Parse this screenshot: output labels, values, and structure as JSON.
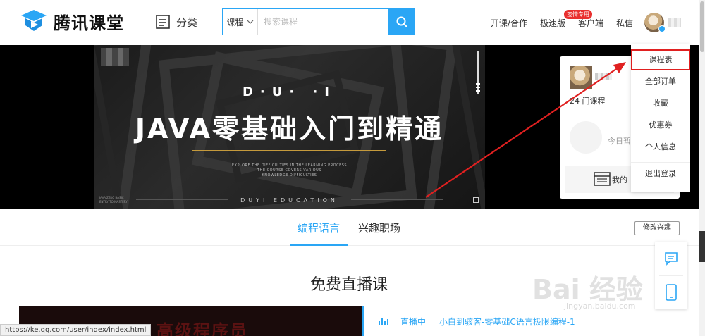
{
  "header": {
    "logo_text": "腾讯课堂",
    "category_label": "分类",
    "search": {
      "scope": "课程",
      "placeholder": "搜索课程"
    },
    "nav": {
      "teach": "开课/合作",
      "express": "极速版",
      "express_badge": "疫情专用",
      "client": "客户端",
      "messages": "私信"
    }
  },
  "banner": {
    "tag": "D·U·  ·I",
    "title": "JAVA零基础入门到精通",
    "subtitle_lines": [
      "EXPLORE THE DIFFICULTIES IN THE LEARNING PROCESS",
      "THE COURSE COVERS VARIOUS",
      "KNOWLEDGE DIFFICULTIES"
    ],
    "footer": "DUYI EDUCATION",
    "corner_lines": [
      "JAVA ZERO BASIC",
      "ENTRY TO MASTERY"
    ]
  },
  "user_panel": {
    "courses": "24 门课程",
    "today": "今日暂",
    "bottom_label": "我的"
  },
  "dropdown": {
    "items": [
      "课程表",
      "全部订单",
      "收藏",
      "优惠券",
      "个人信息"
    ],
    "logout": "退出登录"
  },
  "tabs": {
    "items": [
      "编程语言",
      "兴趣职场"
    ],
    "edit_interest": "修改兴趣"
  },
  "section": {
    "title": "免费直播课"
  },
  "live": {
    "video_text": "高级程序员",
    "status": "直播中",
    "course": "小白到骇客-零基础C语言极限编程-1"
  },
  "status_bar": {
    "url": "https://ke.qq.com/user/index/index.html"
  },
  "watermark": {
    "brand": "Bai 经验",
    "domain": "jingyan.baidu.com"
  },
  "colors": {
    "accent": "#2aa6f5",
    "highlight": "#e02020",
    "badge": "#e9302f"
  }
}
